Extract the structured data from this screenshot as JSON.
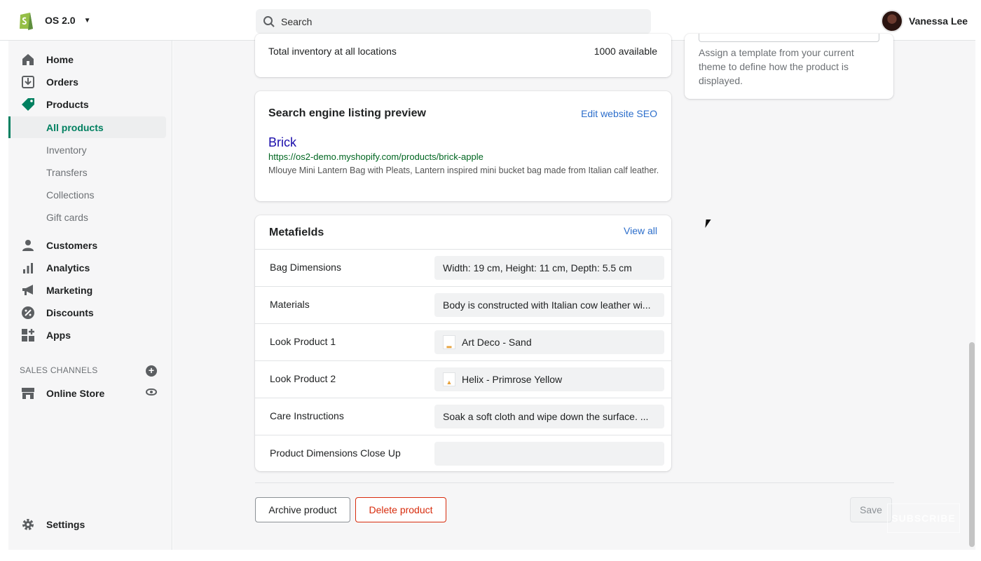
{
  "topbar": {
    "store_name": "OS 2.0",
    "search_placeholder": "Search",
    "user_name": "Vanessa Lee"
  },
  "sidebar": {
    "nav": {
      "home": "Home",
      "orders": "Orders",
      "products": "Products",
      "customers": "Customers",
      "analytics": "Analytics",
      "marketing": "Marketing",
      "discounts": "Discounts",
      "apps": "Apps",
      "settings": "Settings"
    },
    "products_sub": [
      "All products",
      "Inventory",
      "Transfers",
      "Collections",
      "Gift cards"
    ],
    "sales_channels_label": "SALES CHANNELS",
    "online_store": "Online Store"
  },
  "inventory": {
    "label": "Total inventory at all locations",
    "value": "1000 available"
  },
  "seo": {
    "title": "Search engine listing preview",
    "edit_link": "Edit website SEO",
    "page_title": "Brick",
    "url": "https://os2-demo.myshopify.com/products/brick-apple",
    "description": "Mlouye Mini Lantern Bag with Pleats, Lantern inspired mini bucket bag made from Italian calf leather."
  },
  "metafields": {
    "title": "Metafields",
    "view_all": "View all",
    "rows": [
      {
        "key": "Bag Dimensions",
        "value": "Width: 19 cm, Height: 11 cm, Depth: 5.5 cm"
      },
      {
        "key": "Materials",
        "value": "Body is constructed with Italian cow leather wi..."
      },
      {
        "key": "Look Product 1",
        "value": "Art Deco - Sand"
      },
      {
        "key": "Look Product 2",
        "value": "Helix - Primrose Yellow"
      },
      {
        "key": "Care Instructions",
        "value": "Soak a soft cloth and wipe down the surface. ..."
      },
      {
        "key": "Product Dimensions Close Up",
        "value": ""
      }
    ]
  },
  "template_card": {
    "text": "Assign a template from your current theme to define how the product is displayed."
  },
  "actions": {
    "archive": "Archive product",
    "delete": "Delete product",
    "save": "Save"
  },
  "watermark": "SUBSCRIBE",
  "colors": {
    "brand_green": "#008060",
    "link_blue": "#2c6ecb",
    "critical_red": "#d72c0d"
  }
}
